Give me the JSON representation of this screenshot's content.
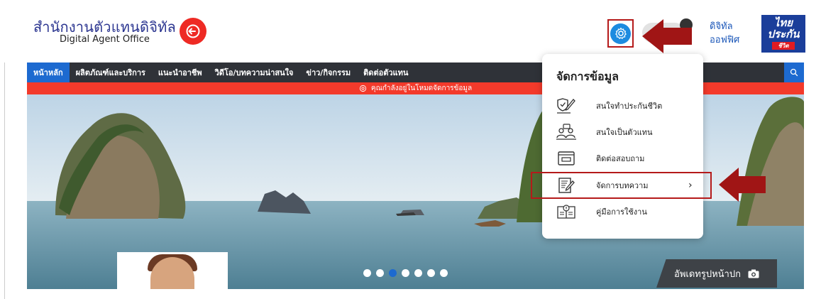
{
  "header": {
    "logo_th": "สำนักงานตัวแทนดิจิทัล",
    "logo_en": "Digital Agent Office",
    "digital_office_line1": "ดิจิทัล",
    "digital_office_line2": "ออฟฟิศ",
    "brand_line1": "ไทย",
    "brand_line2": "ประกัน",
    "brand_line3": "ชีวิต"
  },
  "nav": {
    "items": [
      {
        "label": "หน้าหลัก",
        "active": true
      },
      {
        "label": "ผลิตภัณฑ์และบริการ"
      },
      {
        "label": "แนะนำอาชีพ"
      },
      {
        "label": "วิดีโอ/บทความน่าสนใจ"
      },
      {
        "label": "ข่าว/กิจกรรม"
      },
      {
        "label": "ติดต่อตัวแทน"
      }
    ]
  },
  "mode_banner": "คุณกำลังอยู่ในโหมดจัดการข้อมูล",
  "dropdown": {
    "title": "จัดการข้อมูล",
    "items": [
      {
        "label": "สนใจทำประกันชีวิต",
        "icon": "shield-pen-icon"
      },
      {
        "label": "สนใจเป็นตัวแทน",
        "icon": "agents-icon"
      },
      {
        "label": "ติดต่อสอบถาม",
        "icon": "contact-form-icon"
      },
      {
        "label": "จัดการบทความ",
        "icon": "article-edit-icon",
        "has_chevron": true,
        "highlighted": true
      },
      {
        "label": "คู่มือการใช้งาน",
        "icon": "manual-book-icon"
      }
    ]
  },
  "hero": {
    "carousel_total": 7,
    "carousel_active": 3,
    "cover_button": "อัพเดทรูปหน้าปก"
  },
  "colors": {
    "accent_blue": "#1d6ad0",
    "banner_red": "#f33a2b",
    "annotation_red": "#b51a1a",
    "brand_navy": "#1b3e9a"
  }
}
